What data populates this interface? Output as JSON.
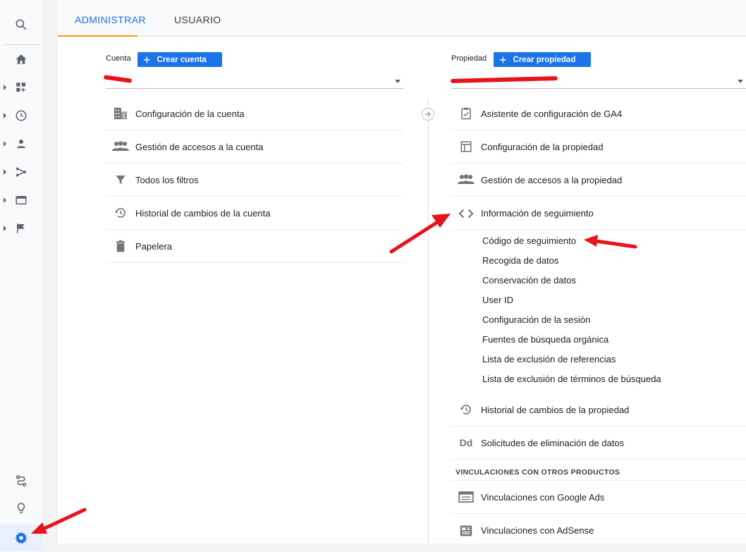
{
  "tabs": [
    {
      "label": "ADMINISTRAR"
    },
    {
      "label": "USUARIO"
    }
  ],
  "account": {
    "label": "Cuenta",
    "create_label": "Crear cuenta",
    "items": [
      {
        "label": "Configuración de la cuenta",
        "icon": "building-icon"
      },
      {
        "label": "Gestión de accesos a la cuenta",
        "icon": "people-icon"
      },
      {
        "label": "Todos los filtros",
        "icon": "filter-icon"
      },
      {
        "label": "Historial de cambios de la cuenta",
        "icon": "history-icon"
      },
      {
        "label": "Papelera",
        "icon": "trash-icon"
      }
    ]
  },
  "property": {
    "label": "Propiedad",
    "create_label": "Crear propiedad",
    "items": [
      {
        "label": "Asistente de configuración de GA4",
        "icon": "clipboard-check-icon"
      },
      {
        "label": "Configuración de la propiedad",
        "icon": "layout-icon"
      },
      {
        "label": "Gestión de accesos a la propiedad",
        "icon": "people-icon"
      },
      {
        "label": "Información de seguimiento",
        "icon": "code-icon"
      }
    ],
    "tracking_subitems": [
      "Código de seguimiento",
      "Recogida de datos",
      "Conservación de datos",
      "User ID",
      "Configuración de la sesión",
      "Fuentes de búsqueda orgánica",
      "Lista de exclusión de referencias",
      "Lista de exclusión de términos de búsqueda"
    ],
    "items_after": [
      {
        "label": "Historial de cambios de la propiedad",
        "icon": "history-icon"
      },
      {
        "label": "Solicitudes de eliminación de datos",
        "icon": "dd-icon",
        "icon_text": "Dd"
      }
    ],
    "linking_header": "VINCULACIONES CON OTROS PRODUCTOS",
    "linking_items": [
      {
        "label": "Vinculaciones con Google Ads",
        "icon": "ads-icon"
      },
      {
        "label": "Vinculaciones con AdSense",
        "icon": "adsense-icon"
      }
    ]
  },
  "colors": {
    "accent": "#1a73e8",
    "tab_underline": "#f29900",
    "annotation": "#e8131b"
  }
}
